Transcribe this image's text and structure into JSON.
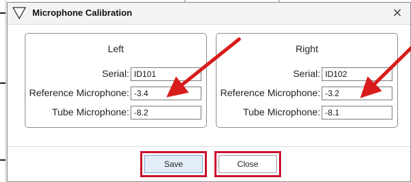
{
  "dialog": {
    "title": "Microphone Calibration",
    "close_glyph": "×"
  },
  "panels": {
    "left": {
      "title": "Left",
      "serial_label": "Serial:",
      "serial_value": "ID101",
      "reference_label": "Reference Microphone:",
      "reference_value": "-3.4",
      "tube_label": "Tube Microphone:",
      "tube_value": "-8.2"
    },
    "right": {
      "title": "Right",
      "serial_label": "Serial:",
      "serial_value": "ID102",
      "reference_label": "Reference Microphone:",
      "reference_value": "-3.2",
      "tube_label": "Tube Microphone:",
      "tube_value": "-8.1"
    }
  },
  "buttons": {
    "save_label": "Save",
    "close_label": "Close"
  },
  "colors": {
    "highlight_red": "#c8102e",
    "arrow_red": "#d81b1b",
    "save_button_bg": "#e3edf8"
  },
  "icons": {
    "title_icon": "triangle-down-icon",
    "close_icon": "close-icon",
    "annotation": "red-arrow-icon"
  }
}
